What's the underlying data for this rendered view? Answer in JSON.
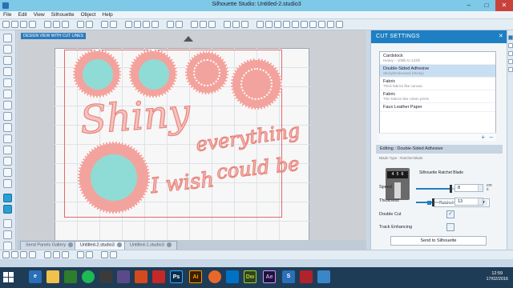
{
  "window": {
    "title": "Silhouette Studio: Untitled-2.studio3",
    "minimize": "–",
    "maximize": "□",
    "close": "✕"
  },
  "menu": [
    "File",
    "Edit",
    "View",
    "Silhouette",
    "Object",
    "Help"
  ],
  "canvas": {
    "design_view_label": "DESIGN VIEW WITH CUT LINES",
    "words": [
      "Shiny",
      "everything",
      "could be",
      "I wish"
    ]
  },
  "tabs": [
    {
      "label": "Send Panels Gallery"
    },
    {
      "label": "Untitled-2.studio3"
    },
    {
      "label": "Untitled-1.studio3"
    }
  ],
  "panel": {
    "header": "CUT SETTINGS",
    "close": "✕",
    "materials": [
      {
        "name": "Cardstock",
        "desc": "Heavy – 105lb to 122lb"
      },
      {
        "name": "Double-Sided Adhesive",
        "desc": "Sticky/Embossed (Sticky)"
      },
      {
        "name": "Fabric",
        "desc": "Thick fabrics like canvas"
      },
      {
        "name": "Fabric",
        "desc": "Thin fabrics like cotton prints"
      },
      {
        "name": "Faux Leather Paper",
        "desc": ""
      }
    ],
    "list_add": "+",
    "list_remove": "–",
    "editing": "Editing : Double-Sided Adhesive",
    "blade_type": "Blade Type : Ratchet Blade",
    "blade_name": "Silhouette Ratchet Blade",
    "blade_dial": "4 5 6",
    "blade_select": "Ratchet Blade",
    "speed_label": "Speed",
    "speed_value": "8",
    "speed_fraction": 0.8,
    "speed_unit_top": "cm",
    "speed_unit_bottom": "s",
    "thickness_label": "Thickness",
    "thickness_value": "13",
    "thickness_fraction": 0.39,
    "double_cut_label": "Double Cut",
    "double_cut_checked": "✓",
    "track_enhancing_label": "Track Enhancing",
    "send_button": "Send to Silhouette"
  },
  "taskbar": {
    "apps": [
      "e",
      "Ps",
      "Ai",
      "Dw",
      "Ae",
      "S"
    ],
    "time": "12:59",
    "date": "17/02/2016"
  }
}
